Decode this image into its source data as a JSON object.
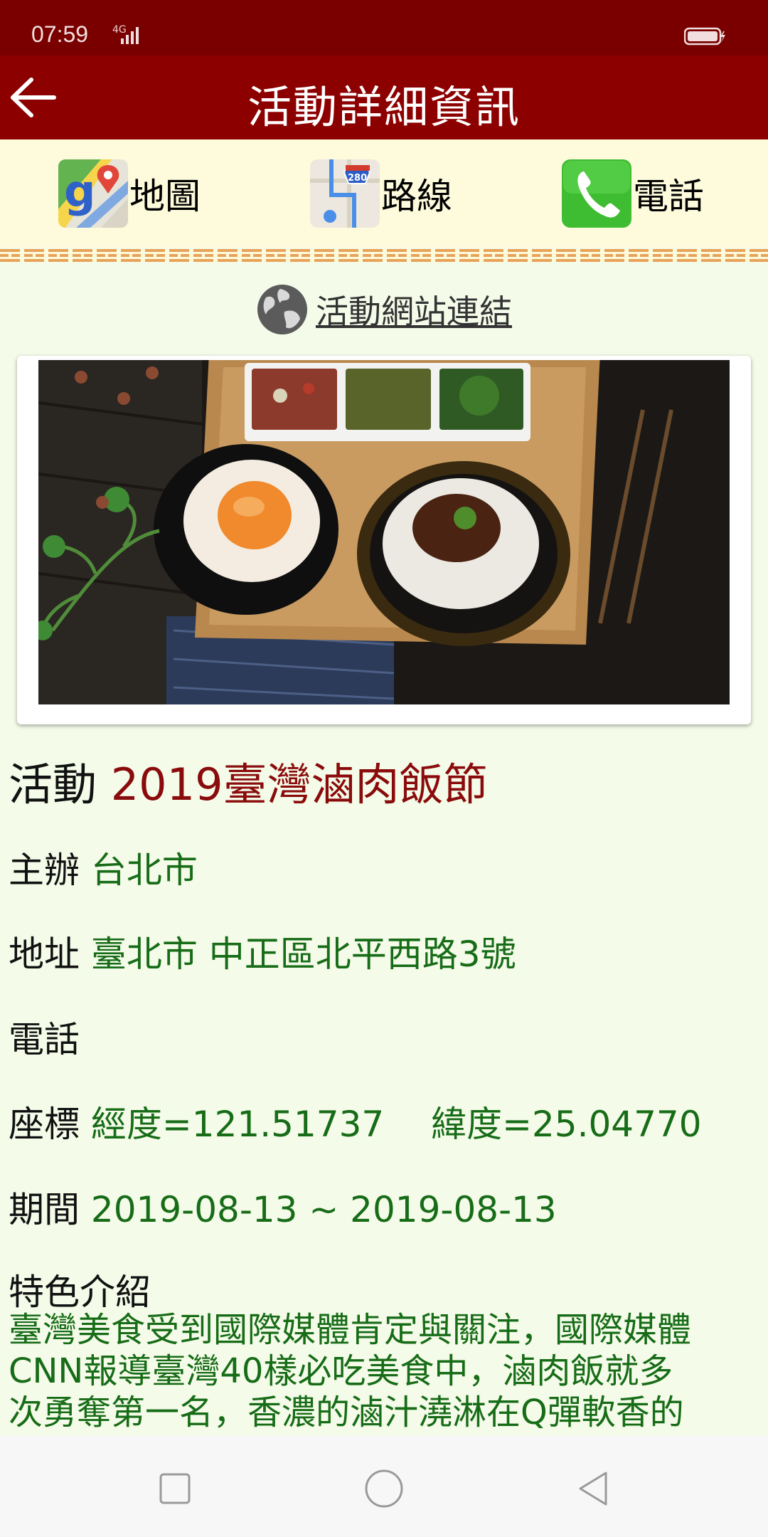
{
  "status": {
    "time": "07:59",
    "network": "4G"
  },
  "header": {
    "title": "活動詳細資訊"
  },
  "actions": [
    {
      "label": "地圖",
      "icon": "google-maps-icon"
    },
    {
      "label": "路線",
      "icon": "route-map-icon"
    },
    {
      "label": "電話",
      "icon": "phone-icon"
    }
  ],
  "website_link": {
    "label": "活動網站連結",
    "icon": "globe-icon"
  },
  "event": {
    "title_key": "活動",
    "title_value": "2019臺灣滷肉飯節",
    "organizer_key": "主辦",
    "organizer_value": "台北市",
    "address_key": "地址",
    "address_value": "臺北市 中正區北平西路3號",
    "phone_key": "電話",
    "phone_value": "",
    "coords_key": "座標",
    "coords_value": "經度=121.51737　 緯度=25.04770",
    "period_key": "期間",
    "period_value": "2019-08-13 ~ 2019-08-13",
    "description_key": "特色介紹",
    "description_lines": [
      "臺灣美食受到國際媒體肯定與關注，國際媒體",
      "CNN報導臺灣40樣必吃美食中，滷肉飯就多",
      "次勇奪第一名，香濃的滷汁澆淋在Q彈軟香的"
    ]
  },
  "colors": {
    "primary": "#8d0000",
    "status": "#7a0000",
    "value_green": "#176c17",
    "title_red": "#8a0b0b",
    "background": "#f4fbe9",
    "action_bg": "#fdfbdc"
  }
}
